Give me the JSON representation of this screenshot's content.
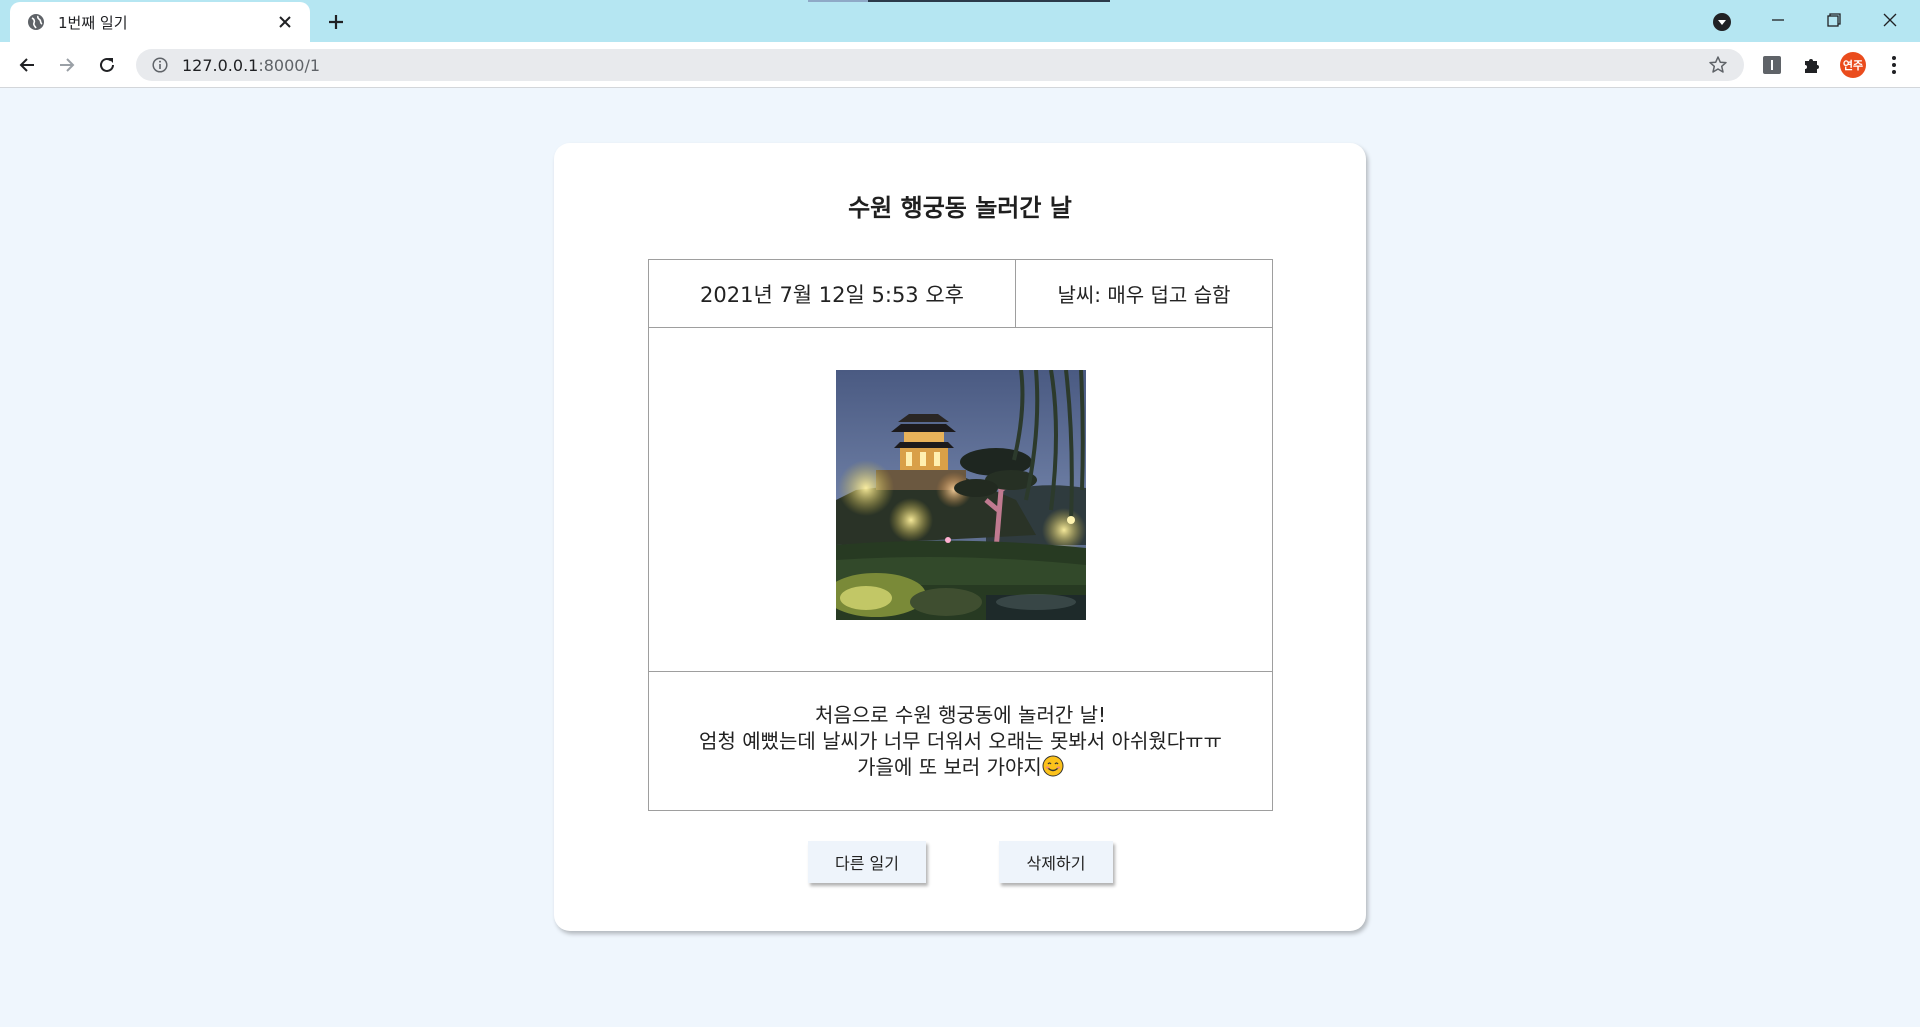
{
  "browser": {
    "tab_title": "1번째 일기",
    "url_host": "127.0.0.1",
    "url_rest": ":8000/1",
    "profile_initials": "연주"
  },
  "diary": {
    "title": "수원 행궁동 놀러간 날",
    "date": "2021년 7월 12일 5:53 오후",
    "weather": "날씨: 매우 덥고 습함",
    "content": [
      "처음으로 수원 행궁동에 놀러간 날!",
      "엄청 예뻤는데 날씨가 너무 더워서 오래는 못봐서 아쉬웠다ㅠㅠ",
      "가을에 또 보러 가야지"
    ],
    "photo_alt": "night view of a lit pavilion on a hill"
  },
  "buttons": {
    "other_label": "다른 일기",
    "delete_label": "삭제하기"
  }
}
